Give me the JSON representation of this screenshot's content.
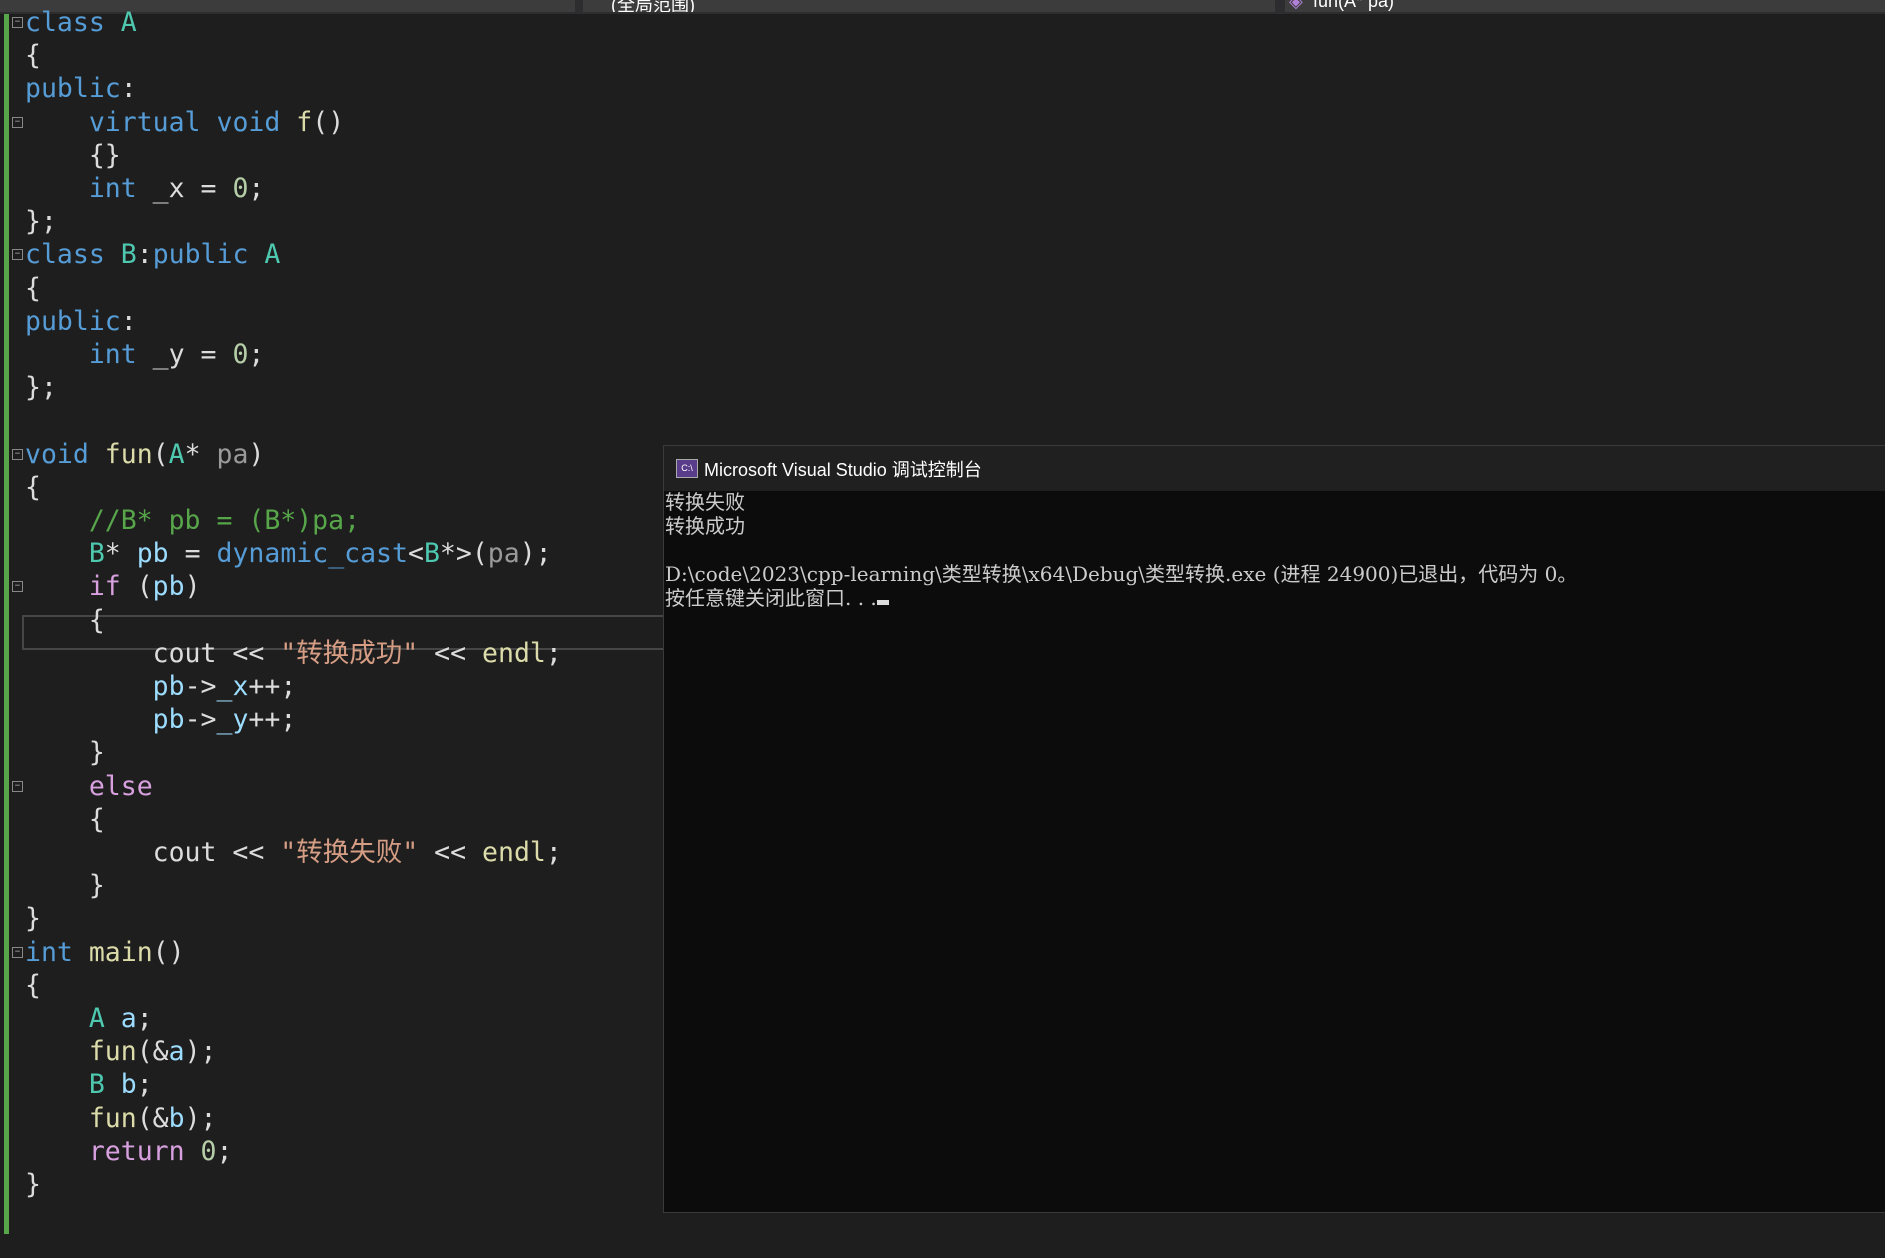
{
  "toolbar": {
    "scope_dropdown": "(全局范围)",
    "member_dropdown": "fun(A* pa)",
    "member_icon": "method-icon"
  },
  "colors": {
    "keyword": "#569cd6",
    "type": "#4ec9b0",
    "function": "#dcdcaa",
    "control": "#d8a0df",
    "variable": "#9cdcfe",
    "string": "#d69d85",
    "comment": "#57a64a",
    "number": "#b5cea8",
    "change_bar": "#57a64a"
  },
  "code": [
    [
      [
        "class",
        "kw"
      ],
      [
        " ",
        "pl"
      ],
      [
        "A",
        "ty"
      ]
    ],
    [
      [
        "{",
        "pl"
      ]
    ],
    [
      [
        "public",
        "kw"
      ],
      [
        ":",
        "pl"
      ]
    ],
    [
      [
        "    ",
        "pl"
      ],
      [
        "virtual",
        "kw"
      ],
      [
        " ",
        "pl"
      ],
      [
        "void",
        "kw"
      ],
      [
        " ",
        "pl"
      ],
      [
        "f",
        "fn"
      ],
      [
        "()",
        "pl"
      ]
    ],
    [
      [
        "    {}",
        "pl"
      ]
    ],
    [
      [
        "    ",
        "pl"
      ],
      [
        "int",
        "kw"
      ],
      [
        " _x = ",
        "pl"
      ],
      [
        "0",
        "nu"
      ],
      [
        ";",
        "pl"
      ]
    ],
    [
      [
        "};",
        "pl"
      ]
    ],
    [
      [
        "class",
        "kw"
      ],
      [
        " ",
        "pl"
      ],
      [
        "B",
        "ty"
      ],
      [
        ":",
        "pl"
      ],
      [
        "public",
        "kw"
      ],
      [
        " ",
        "pl"
      ],
      [
        "A",
        "ty"
      ]
    ],
    [
      [
        "{",
        "pl"
      ]
    ],
    [
      [
        "public",
        "kw"
      ],
      [
        ":",
        "pl"
      ]
    ],
    [
      [
        "    ",
        "pl"
      ],
      [
        "int",
        "kw"
      ],
      [
        " _y = ",
        "pl"
      ],
      [
        "0",
        "nu"
      ],
      [
        ";",
        "pl"
      ]
    ],
    [
      [
        "};",
        "pl"
      ]
    ],
    [],
    [
      [
        "void",
        "kw"
      ],
      [
        " ",
        "pl"
      ],
      [
        "fun",
        "fn"
      ],
      [
        "(",
        "pl"
      ],
      [
        "A",
        "ty"
      ],
      [
        "* ",
        "pl"
      ],
      [
        "pa",
        "pa"
      ],
      [
        ")",
        "pl"
      ]
    ],
    [
      [
        "{",
        "pl"
      ]
    ],
    [
      [
        "    //B* pb = (B*)pa;",
        "cm"
      ]
    ],
    [
      [
        "    ",
        "pl"
      ],
      [
        "B",
        "ty"
      ],
      [
        "* ",
        "pl"
      ],
      [
        "pb",
        "va"
      ],
      [
        " = ",
        "pl"
      ],
      [
        "dynamic_cast",
        "kw"
      ],
      [
        "<",
        "pl"
      ],
      [
        "B",
        "ty"
      ],
      [
        "*>(",
        "pl"
      ],
      [
        "pa",
        "pa"
      ],
      [
        ");",
        "pl"
      ]
    ],
    [
      [
        "    ",
        "pl"
      ],
      [
        "if",
        "ct"
      ],
      [
        " (",
        "pl"
      ],
      [
        "pb",
        "va"
      ],
      [
        ")",
        "pl"
      ]
    ],
    [
      [
        "    {",
        "pl"
      ]
    ],
    [
      [
        "        cout << ",
        "pl"
      ],
      [
        "\"转换成功\"",
        "st"
      ],
      [
        " << ",
        "pl"
      ],
      [
        "endl",
        "fn"
      ],
      [
        ";",
        "pl"
      ]
    ],
    [
      [
        "        ",
        "pl"
      ],
      [
        "pb",
        "va"
      ],
      [
        "->",
        "pl"
      ],
      [
        "_x",
        "va"
      ],
      [
        "++;",
        "pl"
      ]
    ],
    [
      [
        "        ",
        "pl"
      ],
      [
        "pb",
        "va"
      ],
      [
        "->",
        "pl"
      ],
      [
        "_y",
        "va"
      ],
      [
        "++;",
        "pl"
      ]
    ],
    [
      [
        "    }",
        "pl"
      ]
    ],
    [
      [
        "    ",
        "pl"
      ],
      [
        "else",
        "ct"
      ]
    ],
    [
      [
        "    {",
        "pl"
      ]
    ],
    [
      [
        "        cout << ",
        "pl"
      ],
      [
        "\"转换失败\"",
        "st"
      ],
      [
        " << ",
        "pl"
      ],
      [
        "endl",
        "fn"
      ],
      [
        ";",
        "pl"
      ]
    ],
    [
      [
        "    }",
        "pl"
      ]
    ],
    [
      [
        "}",
        "pl"
      ]
    ],
    [
      [
        "int",
        "kw"
      ],
      [
        " ",
        "pl"
      ],
      [
        "main",
        "fn"
      ],
      [
        "()",
        "pl"
      ]
    ],
    [
      [
        "{",
        "pl"
      ]
    ],
    [
      [
        "    ",
        "pl"
      ],
      [
        "A",
        "ty"
      ],
      [
        " ",
        "pl"
      ],
      [
        "a",
        "va"
      ],
      [
        ";",
        "pl"
      ]
    ],
    [
      [
        "    ",
        "pl"
      ],
      [
        "fun",
        "fn"
      ],
      [
        "(&",
        "pl"
      ],
      [
        "a",
        "va"
      ],
      [
        ");",
        "pl"
      ]
    ],
    [
      [
        "    ",
        "pl"
      ],
      [
        "B",
        "ty"
      ],
      [
        " ",
        "pl"
      ],
      [
        "b",
        "va"
      ],
      [
        ";",
        "pl"
      ]
    ],
    [
      [
        "    ",
        "pl"
      ],
      [
        "fun",
        "fn"
      ],
      [
        "(&",
        "pl"
      ],
      [
        "b",
        "va"
      ],
      [
        ");",
        "pl"
      ]
    ],
    [
      [
        "    ",
        "pl"
      ],
      [
        "return",
        "ct"
      ],
      [
        " ",
        "pl"
      ],
      [
        "0",
        "nu"
      ],
      [
        ";",
        "pl"
      ]
    ],
    [
      [
        "}",
        "pl"
      ]
    ]
  ],
  "console": {
    "title": "Microsoft Visual Studio 调试控制台",
    "icon": "console-app-icon",
    "lines": [
      "转换失败",
      "转换成功",
      "",
      "D:\\code\\2023\\cpp-learning\\类型转换\\x64\\Debug\\类型转换.exe (进程 24900)已退出，代码为 0。",
      "按任意键关闭此窗口. . ."
    ]
  }
}
